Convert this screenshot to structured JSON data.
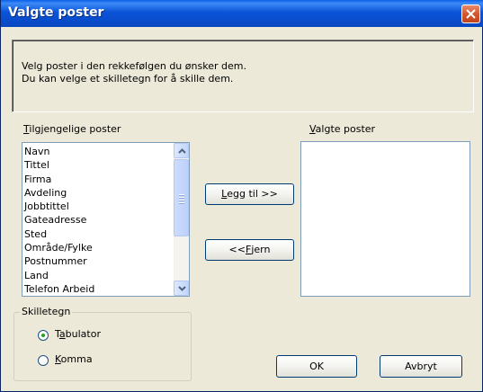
{
  "window": {
    "title": "Valgte poster",
    "close_icon": "close-icon"
  },
  "description": {
    "line1": "Velg poster i den rekkefølgen du ønsker dem.",
    "line2": "Du kan velge et skilletegn for å skille dem."
  },
  "available": {
    "label_first": "T",
    "label_rest": "ilgjengelige poster",
    "items": [
      "Navn",
      "Tittel",
      "Firma",
      "Avdeling",
      "Jobbtittel",
      "Gateadresse",
      "Sted",
      "Område/Fylke",
      "Postnummer",
      "Land",
      "Telefon Arbeid"
    ]
  },
  "selected": {
    "label_first": "V",
    "label_rest": "algte poster",
    "items": []
  },
  "buttons": {
    "add_first": "L",
    "add_rest": "egg til >>",
    "remove_pre": "<< ",
    "remove_first": "F",
    "remove_rest": "jern",
    "ok": "OK",
    "cancel": "Avbryt"
  },
  "separator": {
    "legend": "Skilletegn",
    "tab_first": "a",
    "tab_pre": "T",
    "tab_rest": "bulator",
    "comma_first": "K",
    "comma_rest": "omma",
    "selected": "Tabulator"
  },
  "colors": {
    "titlebar": "#0b54d8",
    "dialog_bg": "#ece9d8",
    "close_red": "#d4582e",
    "radio_dot": "#21a121"
  }
}
